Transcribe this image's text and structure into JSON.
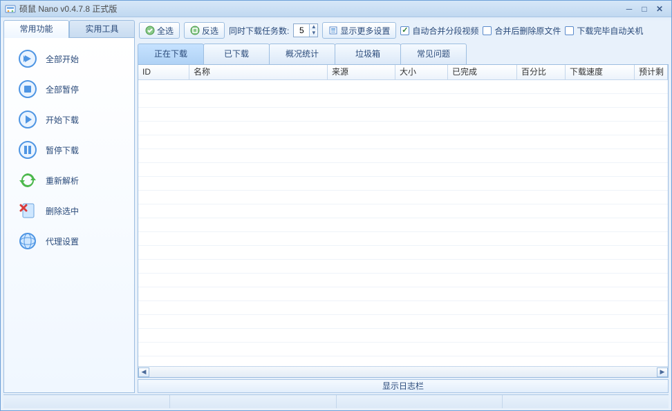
{
  "title": "硕鼠 Nano v0.4.7.8 正式版",
  "leftTabs": {
    "t0": "常用功能",
    "t1": "实用工具"
  },
  "sidebar": {
    "items": [
      {
        "label": "全部开始"
      },
      {
        "label": "全部暂停"
      },
      {
        "label": "开始下载"
      },
      {
        "label": "暂停下载"
      },
      {
        "label": "重新解析"
      },
      {
        "label": "删除选中"
      },
      {
        "label": "代理设置"
      }
    ]
  },
  "toolbar": {
    "selectAll": "全选",
    "invertSelect": "反选",
    "concurrentLabel": "同时下载任务数:",
    "concurrentValue": "5",
    "showMore": "显示更多设置",
    "cbAutoMerge": "自动合并分段视频",
    "cbDeleteAfterMerge": "合并后删除原文件",
    "cbShutdown": "下载完毕自动关机"
  },
  "contentTabs": {
    "t0": "正在下载",
    "t1": "已下载",
    "t2": "概况统计",
    "t3": "垃圾箱",
    "t4": "常见问题"
  },
  "columns": {
    "c0": "ID",
    "c1": "名称",
    "c2": "来源",
    "c3": "大小",
    "c4": "已完成",
    "c5": "百分比",
    "c6": "下载速度",
    "c7": "预计剩"
  },
  "logbar": "显示日志栏"
}
